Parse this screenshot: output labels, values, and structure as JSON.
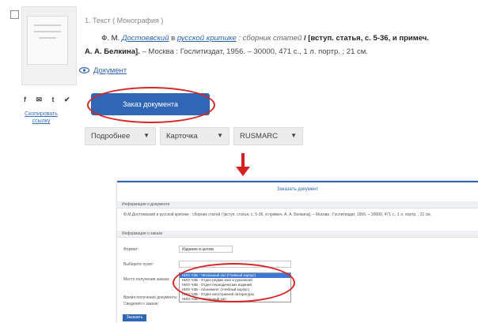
{
  "record": {
    "type_line": "1. Текст ( Монография )",
    "author": "Ф. М.",
    "title_link": "Достоевский",
    "conj": "в",
    "title_link2": "русской критике",
    "subtitle": ": сборник статей",
    "bold_part": "/ [вступ. статья, с. 5-36, и примеч. А. А. Белкина].",
    "imprint": "– Москва : Гослитиздат, 1956. – 30000, 471 с., 1 л. портр. ; 21 см."
  },
  "sidebar": {
    "share_icons": "f ✉ t ✔",
    "rss_label": "Скопировать ссылку"
  },
  "document_link": "Документ",
  "order_button": "Заказ документа",
  "selects": [
    {
      "label": "Подробнее"
    },
    {
      "label": "Карточка"
    },
    {
      "label": "RUSMARC"
    }
  ],
  "form": {
    "title": "Заказать документ",
    "band1": "Информация о документе",
    "record_text": "Ф.М.Достоевский в русской критике : сборник статей / [вступ. статья, с. 5-36, и примеч. А. А. Белкина]. – Москва : Гослитиздат, 1956. – 30000, 471 с., 1 л. портр. ; 21 см.",
    "band2": "Информация о заказе",
    "row1_label": "Формат:",
    "row1_value": "Издание в целом",
    "row2_label": "Выберите пункт:",
    "row3_label": "Место получения заказа:",
    "row4_label": "Время получения документа:",
    "row5_label": "Сведения о заказе:",
    "options": [
      "НИО ЧЗБ - Читальный зал (Главный корпус)",
      "НИО ЧЗБ - Отдел редких книг и рукописей",
      "НИО ЧЗБ - Отдел периодических изданий",
      "НИО ЧЗБ - Абонемент (Учебный корпус)",
      "НИО ЧЗБ - Отдел иностранной литературы",
      "НИО ЧЗБ - Читальный зал"
    ],
    "submit": "Заказать"
  },
  "colors": {
    "accent": "#2f66b5",
    "highlight": "#d82424"
  }
}
